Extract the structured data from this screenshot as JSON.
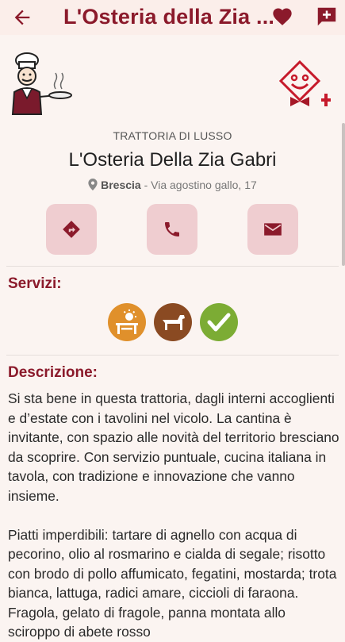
{
  "header": {
    "title": "L'Osteria della Zia ...",
    "back_icon": "arrow-left-icon",
    "favorite_icon": "heart-icon",
    "add_comment_icon": "message-plus-icon"
  },
  "restaurant": {
    "category": "TRATTORIA DI LUSSO",
    "name": "L'Osteria Della Zia Gabri",
    "city": "Brescia",
    "street": " - Via agostino gallo, 17"
  },
  "actions": [
    {
      "name": "directions",
      "icon": "directions-icon"
    },
    {
      "name": "call",
      "icon": "phone-icon"
    },
    {
      "name": "email",
      "icon": "envelope-icon"
    }
  ],
  "services": {
    "title": "Servizi:",
    "items": [
      {
        "icon": "outdoor-terrace-icon",
        "color": "#e0902b"
      },
      {
        "icon": "dog-icon",
        "color": "#8a4a22"
      },
      {
        "icon": "vegetarian-check-icon",
        "color": "#7cac34"
      }
    ]
  },
  "description": {
    "title": "Descrizione:",
    "paragraph1": "Si sta bene in questa trattoria, dagli interni accoglienti e d’estate con i tavolini nel vicolo. La cantina è invitante, con spazio alle novità del territorio bresciano da scoprire. Con servizio puntuale, cucina italiana in tavola, con tradizione e innovazione che vanno insieme.",
    "paragraph2": "Piatti imperdibili: tartare di agnello con acqua di pecorino, olio al rosmarino e cialda di segale; risotto con brodo di pollo affumicato, fegatini, mostarda; trota bianca, lattuga, radici amare, ciccioli di faraona. Fragola, gelato di fragole, panna montata allo sciroppo di abete rosso"
  },
  "colors": {
    "brand": "#8b1a2b",
    "button_bg": "#efcdd0",
    "background": "#fbf4f1"
  }
}
